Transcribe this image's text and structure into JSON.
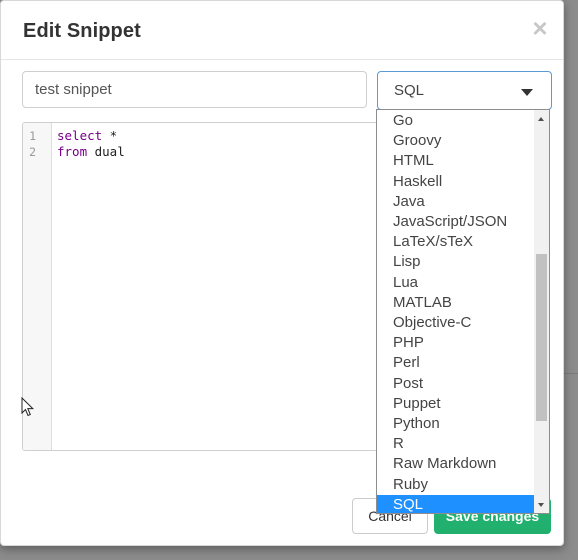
{
  "dialog": {
    "title": "Edit Snippet",
    "close_glyph": "×"
  },
  "form": {
    "name_value": "test snippet",
    "language_value": "SQL"
  },
  "editor": {
    "line_numbers": [
      "1",
      "2"
    ],
    "lines": [
      {
        "keyword": "select",
        "rest": " *"
      },
      {
        "keyword": "from",
        "rest": " dual"
      }
    ]
  },
  "dropdown": {
    "options": [
      "Go",
      "Groovy",
      "HTML",
      "Haskell",
      "Java",
      "JavaScript/JSON",
      "LaTeX/sTeX",
      "Lisp",
      "Lua",
      "MATLAB",
      "Objective-C",
      "PHP",
      "Perl",
      "Post",
      "Puppet",
      "Python",
      "R",
      "Raw Markdown",
      "Ruby",
      "SQL"
    ],
    "selected": "SQL"
  },
  "footer": {
    "cancel_label": "Cancel",
    "save_label": "Save changes"
  },
  "colors": {
    "accent_blue": "#1e90ff",
    "save_green": "#22b06e",
    "keyword_purple": "#770088"
  },
  "icons": {
    "close": "close-icon",
    "caret": "chevron-down-icon",
    "cursor": "mouse-pointer-icon"
  }
}
